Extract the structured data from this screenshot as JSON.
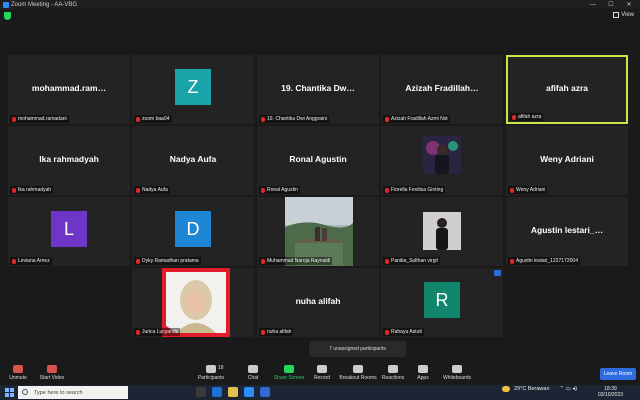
{
  "window": {
    "title": "Zoom Meeting - AA-VBG",
    "minimize": "—",
    "maximize": "☐",
    "close": "✕"
  },
  "topbar": {
    "view_label": "View"
  },
  "tiles": [
    {
      "big": "mohammad.ram…",
      "label": "mohammad.ramadani"
    },
    {
      "avatar": "Z",
      "label": "zoom baa04"
    },
    {
      "big": "19. Chantika Dw…",
      "label": "19. Chantika Dwi Anggraini"
    },
    {
      "big": "Azizah Fradillah…",
      "label": "Azizah Fradillah Azmi Nst"
    },
    {
      "big": "afifah azra",
      "label": "afifah azra"
    },
    {
      "big": "Ika rahmadyah",
      "label": "Ika rahmadyah"
    },
    {
      "big": "Nadya Aufa",
      "label": "Nadya Aufa"
    },
    {
      "big": "Ronal Agustin",
      "label": "Ronal Agustin"
    },
    {
      "label": "Fiorella Fenilisa Ginting"
    },
    {
      "big": "Weny Adriani",
      "label": "Weny Adriani"
    },
    {
      "avatar": "L",
      "label": "Leviana Arnez"
    },
    {
      "avatar": "D",
      "label": "Dyky Ramadhan pratama"
    },
    {
      "label": "Muhammad Naroja Raynaldi"
    },
    {
      "label": "Panitia_Sulthan virgil"
    },
    {
      "big": "Agustin lestari_…",
      "label": "Agustin lestari_1227172004"
    },
    {
      "label": "Jurica Lucyanda"
    },
    {
      "big": "nuha alifah",
      "label": "nuha alifah"
    },
    {
      "avatar": "R",
      "label": "Rahayu Astuti"
    }
  ],
  "tooltip": "7 unassigned participants",
  "toolbar": {
    "unmute": "Unmute",
    "start_video": "Start Video",
    "participants": "Participants",
    "participants_count": "18",
    "chat": "Chat",
    "share": "Share Screen",
    "record": "Record",
    "breakout": "Breakout Rooms",
    "reactions": "Reactions",
    "apps": "Apps",
    "whiteboards": "Whiteboards",
    "leave": "Leave Room"
  },
  "taskbar": {
    "search_placeholder": "Type here to search",
    "weather": "29°C  Berawan",
    "time": "18:39",
    "date": "03/10/2023"
  },
  "colors": {
    "active_border": "#c8e64a",
    "avatar_Z": "#1aa3a8",
    "avatar_L": "#6e36c7",
    "avatar_D": "#1f86d6",
    "avatar_R": "#12866d",
    "leave": "#2d6cdf"
  }
}
